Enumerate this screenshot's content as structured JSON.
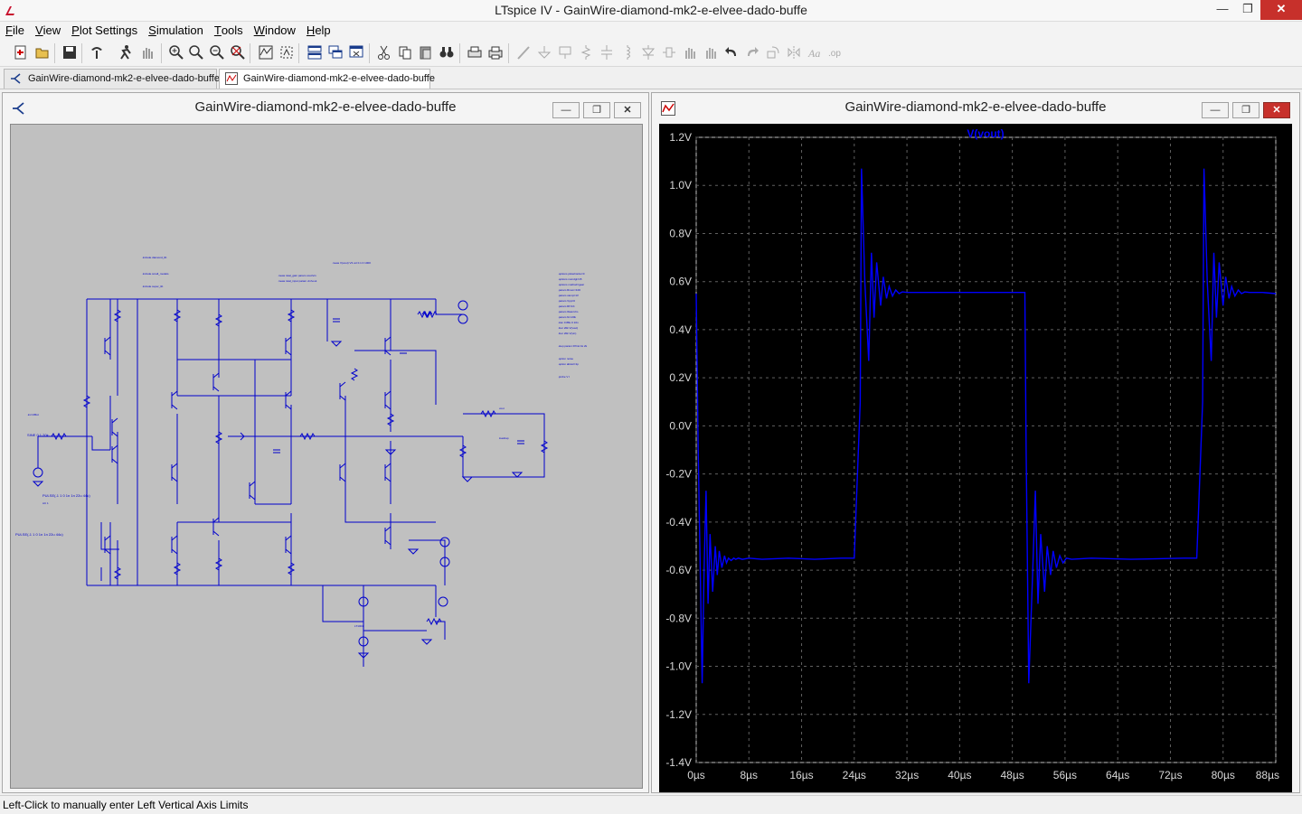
{
  "window": {
    "title": "LTspice IV - GainWire-diamond-mk2-e-elvee-dado-buffe",
    "controls": {
      "minimize": "—",
      "restore": "❐",
      "close": "✕"
    }
  },
  "menu": [
    {
      "label": "File"
    },
    {
      "label": "View"
    },
    {
      "label": "Plot Settings"
    },
    {
      "label": "Simulation"
    },
    {
      "label": "Tools"
    },
    {
      "label": "Window"
    },
    {
      "label": "Help"
    }
  ],
  "tabs": [
    {
      "label": "GainWire-diamond-mk2-e-elvee-dado-buffe",
      "kind": "schematic"
    },
    {
      "label": "GainWire-diamond-mk2-e-elvee-dado-buffe",
      "kind": "waveform",
      "active": true
    }
  ],
  "schematic_window": {
    "title": "GainWire-diamond-mk2-e-elvee-dado-buffe",
    "buttons": {
      "minimize": "—",
      "restore": "❐",
      "close": "✕"
    }
  },
  "plot_window": {
    "title": "GainWire-diamond-mk2-e-elvee-dado-buffe",
    "buttons": {
      "minimize": "—",
      "restore": "❐",
      "close": "✕"
    }
  },
  "status_text": "Left-Click to manually enter Left Vertical Axis Limits",
  "colors": {
    "trace": "#0000ff",
    "plot_bg": "#000000",
    "grid": "#606060",
    "axis_text": "#d8d8d8",
    "schem_bg": "#c0c0c0",
    "wire": "#0000cc"
  },
  "chart_data": {
    "type": "line",
    "title": "",
    "series": [
      {
        "name": "V(vout)",
        "x": [
          0,
          0.3,
          0.9,
          1.2,
          1.5,
          1.8,
          2.1,
          2.5,
          2.9,
          3.2,
          3.5,
          3.9,
          4.3,
          4.6,
          4.9,
          5.3,
          5.7,
          6.0,
          6.4,
          7.0,
          8.0,
          10,
          14,
          18,
          22,
          24.0,
          24.9,
          25.1,
          25.6,
          26.2,
          26.6,
          27.0,
          27.4,
          28.0,
          28.4,
          28.9,
          29.3,
          29.8,
          30.3,
          30.8,
          31.3,
          32,
          34,
          40,
          46,
          49.9,
          50.1,
          50.5,
          51.1,
          51.5,
          51.9,
          52.3,
          52.9,
          53.3,
          53.8,
          54.2,
          54.7,
          55.2,
          55.7,
          56.2,
          57,
          60,
          66,
          74,
          76.0,
          76.9,
          77.1,
          77.6,
          78.2,
          78.6,
          79.0,
          79.4,
          80.0,
          80.4,
          80.9,
          81.3,
          81.8,
          82.3,
          82.8,
          83.3,
          84,
          86,
          88
        ],
        "y": [
          0.55,
          -0.1,
          -1.07,
          -0.6,
          -0.27,
          -0.74,
          -0.45,
          -0.69,
          -0.5,
          -0.62,
          -0.52,
          -0.59,
          -0.54,
          -0.57,
          -0.55,
          -0.56,
          -0.55,
          -0.555,
          -0.55,
          -0.555,
          -0.55,
          -0.555,
          -0.55,
          -0.555,
          -0.55,
          -0.55,
          0.1,
          1.07,
          0.6,
          0.27,
          0.72,
          0.45,
          0.68,
          0.5,
          0.62,
          0.53,
          0.58,
          0.54,
          0.565,
          0.55,
          0.557,
          0.555,
          0.555,
          0.555,
          0.555,
          0.555,
          -0.1,
          -1.07,
          -0.6,
          -0.27,
          -0.74,
          -0.45,
          -0.69,
          -0.5,
          -0.62,
          -0.52,
          -0.59,
          -0.54,
          -0.57,
          -0.55,
          -0.555,
          -0.55,
          -0.555,
          -0.55,
          -0.55,
          0.1,
          1.07,
          0.6,
          0.27,
          0.72,
          0.45,
          0.68,
          0.5,
          0.62,
          0.53,
          0.58,
          0.54,
          0.565,
          0.55,
          0.557,
          0.555,
          0.555,
          0.55
        ]
      }
    ],
    "xlim": [
      0,
      88
    ],
    "ylim": [
      -1.4,
      1.2
    ],
    "xticks": [
      0,
      8,
      16,
      24,
      32,
      40,
      48,
      56,
      64,
      72,
      80,
      88
    ],
    "xtick_labels": [
      "0µs",
      "8µs",
      "16µs",
      "24µs",
      "32µs",
      "40µs",
      "48µs",
      "56µs",
      "64µs",
      "72µs",
      "80µs",
      "88µs"
    ],
    "yticks": [
      1.2,
      1.0,
      0.8,
      0.6,
      0.4,
      0.2,
      0.0,
      -0.2,
      -0.4,
      -0.6,
      -0.8,
      -1.0,
      -1.2,
      -1.4
    ],
    "ytick_labels": [
      "1.2V",
      "1.0V",
      "0.8V",
      "0.6V",
      "0.4V",
      "0.2V",
      "0.0V",
      "-0.2V",
      "-0.4V",
      "-0.6V",
      "-0.8V",
      "-1.0V",
      "-1.2V",
      "-1.4V"
    ],
    "grid": true,
    "legend": "top-center"
  }
}
